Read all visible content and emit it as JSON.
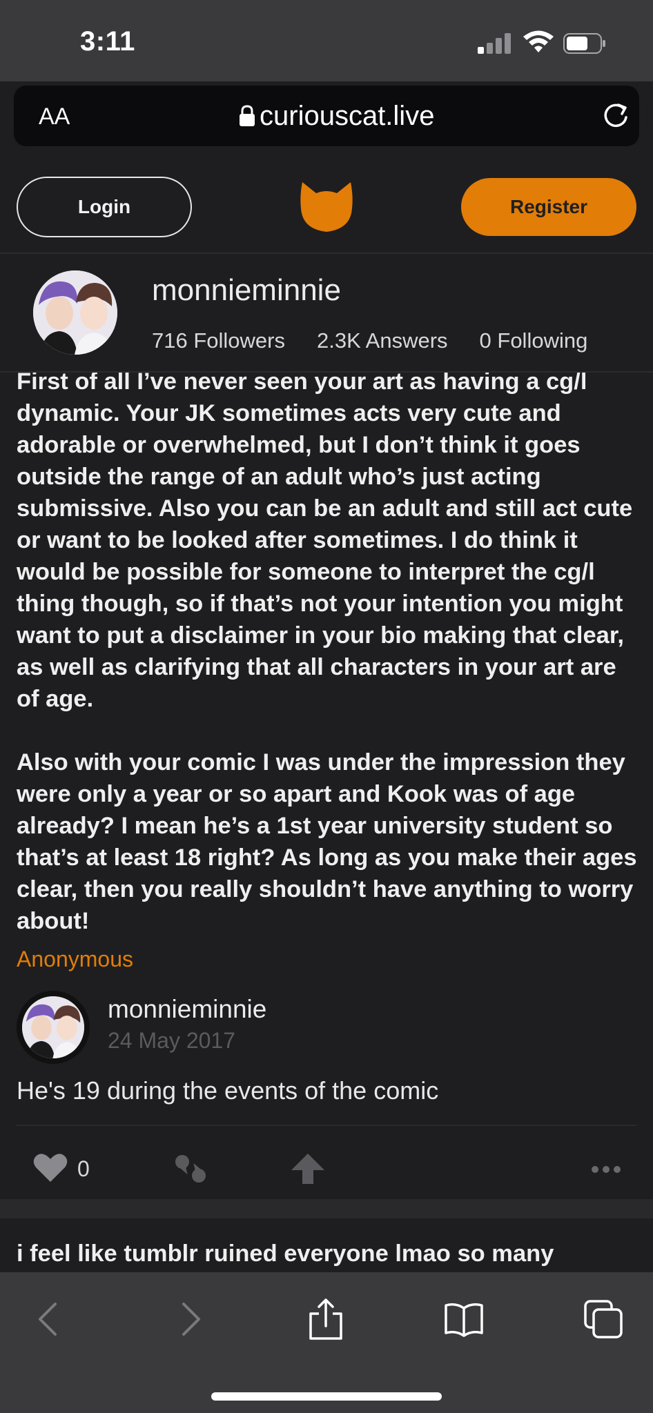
{
  "status_bar": {
    "time": "3:11"
  },
  "browser": {
    "aa_label": "AA",
    "url": "curiouscat.live"
  },
  "header": {
    "login_label": "Login",
    "register_label": "Register",
    "brand_color": "#e27d08"
  },
  "profile": {
    "username": "monnieminnie",
    "followers": "716 Followers",
    "answers": "2.3K Answers",
    "following": "0 Following"
  },
  "post": {
    "question": "First of all I’ve never seen your art as having a cg/l dynamic. Your JK sometimes acts very cute and adorable or overwhelmed, but I don’t think it goes outside the range of an adult who’s just acting submissive. Also you can be an adult and still act cute or want to be looked after sometimes. I do think it would be possible for someone to interpret the cg/l thing though, so if that’s not your intention you might want to put a disclaimer in your bio making that clear, as well as clarifying that all characters in your art are of age.\n\nAlso with your comic I was under the impression they were only a year or so apart and Kook was of age already? I mean he’s a 1st year university student so that’s at least 18 right? As long as you make their ages clear, then you really shouldn’t have anything to worry about!",
    "asker": "Anonymous",
    "answer_user": "monnieminnie",
    "answer_date": "24 May 2017",
    "answer": "He's 19 during the events of the comic",
    "like_count": "0"
  },
  "next_post": {
    "question": "i feel like tumblr ruined everyone lmao so many"
  }
}
